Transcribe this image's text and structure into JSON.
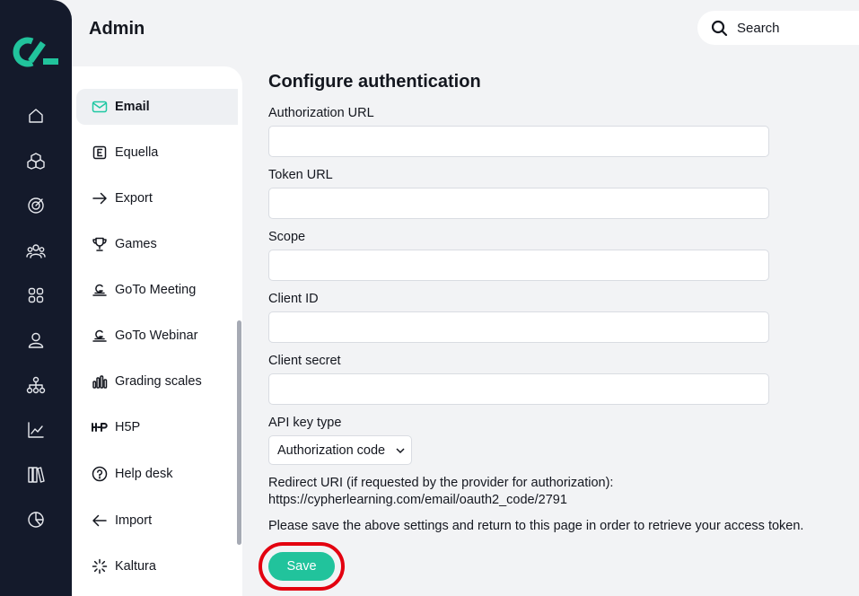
{
  "header": {
    "title": "Admin",
    "search_label": "Search"
  },
  "rail": {
    "icons": [
      "home-icon",
      "cubes-icon",
      "target-icon",
      "people-icon",
      "grid-icon",
      "user-icon",
      "hierarchy-icon",
      "chart-icon",
      "books-icon",
      "pie-chart-icon"
    ]
  },
  "subnav": {
    "items": [
      {
        "label": "Email",
        "icon": "mail-icon",
        "active": true
      },
      {
        "label": "Equella",
        "icon": "equella-icon"
      },
      {
        "label": "Export",
        "icon": "arrow-right-icon"
      },
      {
        "label": "Games",
        "icon": "trophy-icon"
      },
      {
        "label": "GoTo Meeting",
        "icon": "goto-icon"
      },
      {
        "label": "GoTo Webinar",
        "icon": "goto-icon"
      },
      {
        "label": "Grading scales",
        "icon": "bars-icon"
      },
      {
        "label": "H5P",
        "icon": "h5p-icon"
      },
      {
        "label": "Help desk",
        "icon": "help-icon"
      },
      {
        "label": "Import",
        "icon": "arrow-left-icon"
      },
      {
        "label": "Kaltura",
        "icon": "kaltura-icon"
      }
    ]
  },
  "form": {
    "title": "Configure authentication",
    "fields": {
      "authorization_url": {
        "label": "Authorization URL",
        "value": ""
      },
      "token_url": {
        "label": "Token URL",
        "value": ""
      },
      "scope": {
        "label": "Scope",
        "value": ""
      },
      "client_id": {
        "label": "Client ID",
        "value": ""
      },
      "client_secret": {
        "label": "Client secret",
        "value": ""
      }
    },
    "api_key_type": {
      "label": "API key type",
      "selected": "Authorization code"
    },
    "redirect_label": "Redirect URI (if requested by the provider for authorization):",
    "redirect_uri": "https://cypherlearning.com/email/oauth2_code/2791",
    "note": "Please save the above settings and return to this page in order to retrieve your access token.",
    "save_label": "Save"
  },
  "colors": {
    "accent": "#21c39c",
    "rail_bg": "#141a2b",
    "highlight_ring": "#e3000f"
  }
}
